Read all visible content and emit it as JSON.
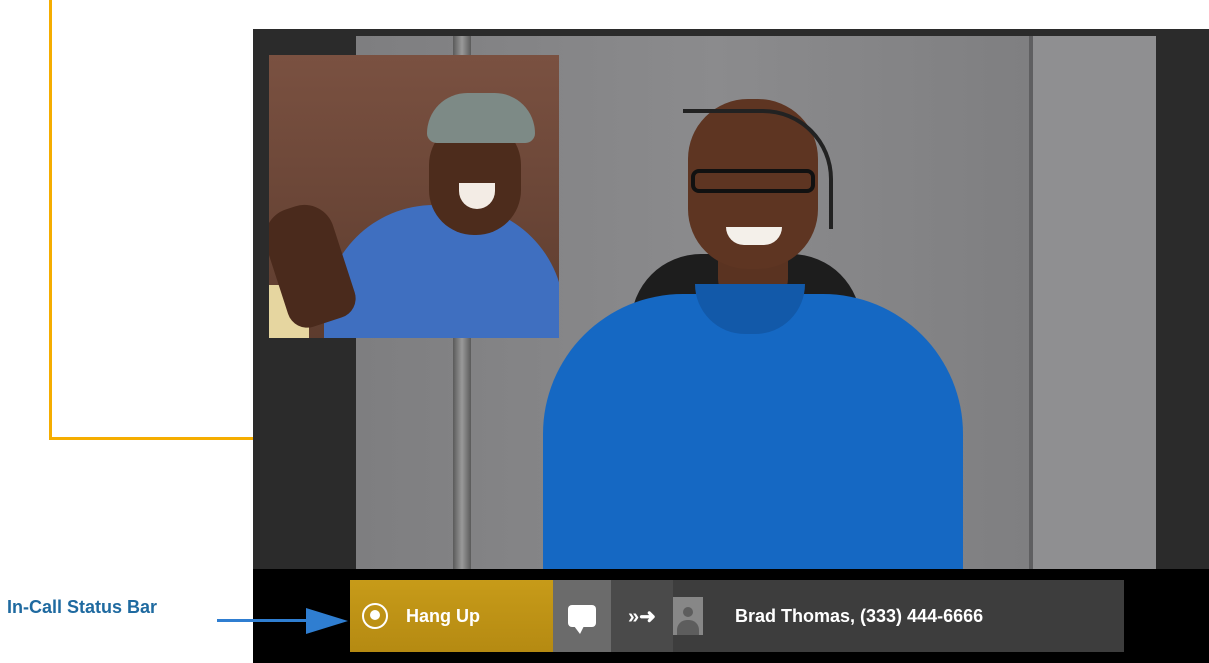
{
  "annotation": {
    "status_bar_label": "In-Call Status Bar"
  },
  "status_bar": {
    "hangup_label": "Hang Up",
    "hangup_icon": "hangup-icon",
    "chat_icon": "chat-bubble-icon",
    "transfer_icon": "transfer-arrow-icon",
    "transfer_glyph": "»➜",
    "avatar_icon": "contact-avatar-icon",
    "caller_info": "Brad Thomas, (333) 444-6666"
  },
  "colors": {
    "hangup_button": "#c79b19",
    "annotation_orange": "#f5ad00",
    "annotation_blue": "#2f7ed1",
    "label_blue": "#1f6aa0",
    "bar_background": "#3d3d3d"
  }
}
